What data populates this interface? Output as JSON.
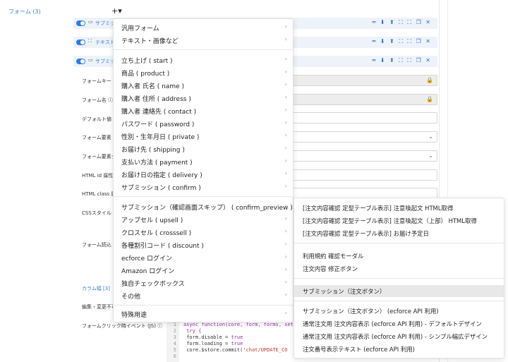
{
  "sidebar": {
    "forms_link": "フォーム (3)"
  },
  "toolbar": {
    "add_label": "+▾"
  },
  "rows": [
    {
      "icon": "▭",
      "label": "サブミッ",
      "actions": "═ ⬇ ⬆  ⛶ ⛶  ❐ ✕"
    },
    {
      "icon": "⛶",
      "label": "テキスト",
      "actions": "═ ⬇ ⬆  ⛶ ⛶  ❐ ✕"
    },
    {
      "icon": "▭",
      "label": "サブミッ",
      "actions": "═ ⬇ ⬆  ⛶ ⛶  ❐ ✕"
    }
  ],
  "fields": [
    {
      "label": "フォームキー"
    },
    {
      "label": "フォーム名 ⓘ"
    },
    {
      "label": "デフォルト値"
    },
    {
      "label": "フォーム要素"
    },
    {
      "label": "フォーム要素ク"
    },
    {
      "label": "HTML id 属性"
    },
    {
      "label": "HTML class 属"
    },
    {
      "label": "CSSスタイル ("
    },
    {
      "label": "フォーム読込"
    }
  ],
  "section": {
    "column_width": "カラム幅 [3]"
  },
  "extra_labels": {
    "edit_lock": "編集・変更不可",
    "click_event": "フォームクリック時イベント (JS) ⓘ"
  },
  "code": {
    "line1": "async function(core, form, forms, settings,",
    "line2": "  try {",
    "line3a": "    form.disable = ",
    "line3b": "true",
    "line4a": "    form.loading = ",
    "line4b": "true",
    "line5a": "    core.$store.commit(",
    "line5b": "'chat/UPDATE_CO",
    "line6": ""
  },
  "menu": {
    "group1": [
      "汎用フォーム",
      "テキスト・画像など"
    ],
    "group2": [
      "立ち上げ ( start )",
      "商品 ( product )",
      "購入者 氏名 ( name )",
      "購入者 住所 ( address )",
      "購入者 連絡先 ( contact )",
      "パスワード ( password )",
      "性別・生年月日 ( private )",
      "お届け先 ( shipping )",
      "支払い方法 ( payment )",
      "お届け日の指定 ( delivery )",
      "サブミッション ( confirm )"
    ],
    "group3": [
      "サブミッション（確認画面スキップ） ( confirm_preview )",
      "アップセル ( upsell )",
      "クロスセル ( crosssell )",
      "各種割引コード ( discount )",
      "ecforce ログイン",
      "Amazon ログイン",
      "独自チェックボックス",
      "その他"
    ],
    "group4": [
      "特殊用途"
    ],
    "arrow": "›"
  },
  "submenu": {
    "group1": [
      "[注文内容確認 定型テーブル表示] 注意喚起文 HTML取得",
      "[注文内容確認 定型テーブル表示] 注意喚起文（上部） HTML取得",
      "[注文内容確認 定型テーブル表示] お届け予定日"
    ],
    "group2": [
      "利用規約 確認モーダル",
      "注文内容 修正ボタン"
    ],
    "group3": [
      "サブミッション（注文ボタン）"
    ],
    "group4": [
      "サブミッション（注文ボタン） (ecforce API 利用)",
      "通常注文用 注文内容表示 (ecforce API 利用) - デフォルトデザイン",
      "通常注文用 注文内容表示 (ecforce API 利用) - シンプル幅広デザイン",
      "注文番号表示テキスト (ecforce API 利用)"
    ]
  },
  "icons": {
    "lock": "🔒",
    "chevron": "⌄"
  },
  "colors": {
    "accent": "#2e7be6",
    "link": "#3a7bd5"
  }
}
